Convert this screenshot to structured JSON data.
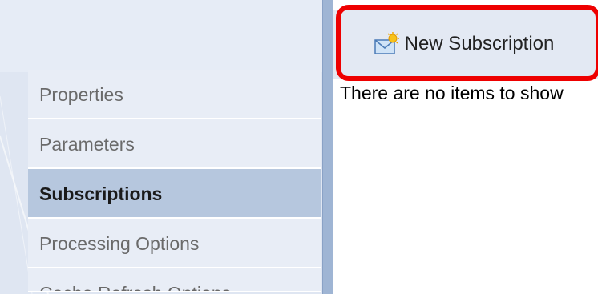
{
  "nav": {
    "items": [
      {
        "label": "Properties",
        "selected": false
      },
      {
        "label": "Parameters",
        "selected": false
      },
      {
        "label": "Subscriptions",
        "selected": true
      },
      {
        "label": "Processing Options",
        "selected": false
      },
      {
        "label": "Cache Refresh Options",
        "selected": false
      }
    ]
  },
  "toolbar": {
    "new_subscription_label": "New Subscription",
    "new_subscription_icon": "envelope-sun-icon"
  },
  "content": {
    "empty_message": "There are no items to show"
  },
  "colors": {
    "highlight": "#ee0000",
    "selected_nav": "#b6c7de",
    "splitter": "#9fb5d4"
  }
}
